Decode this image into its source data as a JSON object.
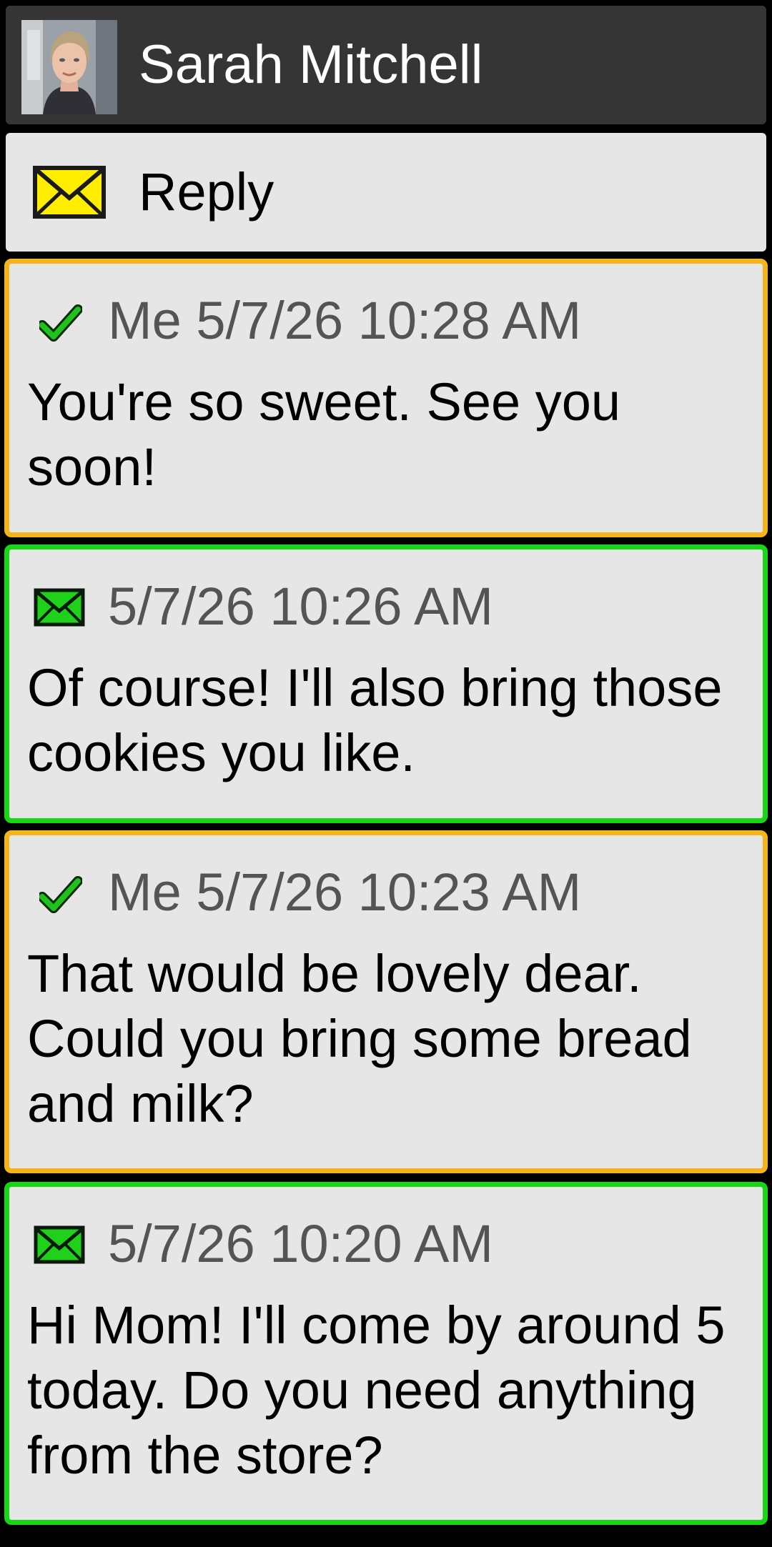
{
  "header": {
    "contact_name": "Sarah Mitchell",
    "avatar_icon": "contact-photo"
  },
  "reply": {
    "label": "Reply",
    "icon": "envelope-icon",
    "icon_color": "#ffee00"
  },
  "colors": {
    "sent_border": "#f5b41a",
    "received_border": "#18d615",
    "card_background": "#e6e6e6",
    "header_background": "#353535"
  },
  "messages": [
    {
      "direction": "sent",
      "icon": "checkmark-icon",
      "meta": "Me 5/7/26 10:28 AM",
      "text": "You're so sweet. See you soon!"
    },
    {
      "direction": "received",
      "icon": "envelope-icon",
      "meta": "5/7/26 10:26 AM",
      "text": "Of course! I'll also bring those cookies you like."
    },
    {
      "direction": "sent",
      "icon": "checkmark-icon",
      "meta": "Me 5/7/26 10:23 AM",
      "text": "That would be lovely dear. Could you bring some bread and milk?"
    },
    {
      "direction": "received",
      "icon": "envelope-icon",
      "meta": "5/7/26 10:20 AM",
      "text": "Hi Mom! I'll come by around 5 today. Do you need anything from the store?"
    }
  ]
}
